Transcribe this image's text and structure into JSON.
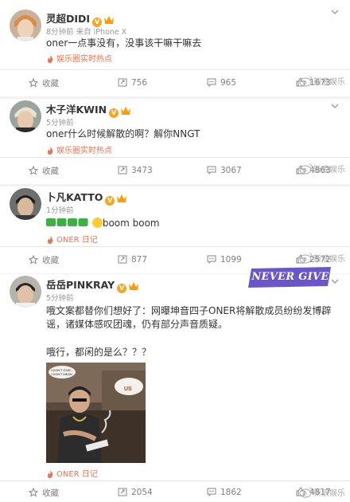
{
  "posts": [
    {
      "username": "灵超DIDI",
      "meta": "8分钟前  来自 iPhone X",
      "text": "oner一点事没有，没事该干嘛干嘛去",
      "tag": "娱乐圈实时热点",
      "collect": "收藏",
      "reposts": "756",
      "comments": "965",
      "likes": "1673"
    },
    {
      "username": "木子洋KWIN",
      "meta": "5分钟前",
      "text": "oner什么时候解散的啊？解你NNGT",
      "tag": "娱乐圈实时热点",
      "collect": "收藏",
      "reposts": "3473",
      "comments": "3067",
      "likes": "4863"
    },
    {
      "username": "卜凡KATTO",
      "meta": "1分钟前",
      "text": "boom boom",
      "text_prefix": "¥¥¥¥",
      "tag": "ONER 日记",
      "collect": "收藏",
      "reposts": "877",
      "comments": "1099",
      "likes": "2572"
    },
    {
      "username": "岳岳PINKRAY",
      "meta": "5分钟前",
      "text": "哦文案都替你们想好了：网曝坤音四子ONER将解散成员纷纷发博辟谣，诸媒体感叹团魂，仍有部分声音质疑。",
      "text2": "哦行，都闲的是么？？？",
      "tag": "ONER 日记",
      "collect": "收藏",
      "reposts": "2054",
      "comments": "1862",
      "likes": "4817"
    }
  ],
  "sticker": "NEVER GIVE UP",
  "photo_text": {
    "speech1": "I DON'T GIVE...",
    "speech2": "I DON'T MEAN",
    "speech3": "US"
  },
  "watermark": "新浪娱乐",
  "colors": {
    "tag": "#eb7350",
    "verified": "#f5a623",
    "sticker_bg": "#6a55c9",
    "green_icons": "#34a853"
  }
}
